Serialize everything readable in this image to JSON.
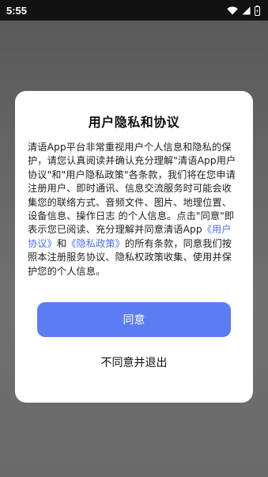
{
  "status_bar": {
    "time": "5:55",
    "icons": [
      "wifi-icon",
      "signal-icon",
      "battery-icon"
    ]
  },
  "dialog": {
    "title": "用户隐私和协议",
    "body": {
      "intro": "清语App平台非常重视用户个人信息和隐私的保护，请您认真阅读并确认充分理解\"清语App用户协议\"和\"用户隐私政策\"各条款，我们将在您申请注册用户、即时通讯、信息交流服务时可能会收集您的联络方式、音频文件、图片、地理位置、设备信息、操作日志 的个人信息。点击\"同意\"即表示您已阅读、充分理解并同意清语App",
      "user_agreement_link": "《用户协议》",
      "connector": "和",
      "privacy_policy_link": "《隐私政策》",
      "outro": "的所有条款，同意我们按照本注册服务协议、隐私权政策收集、使用并保护您的个人信息。"
    },
    "agree_label": "同意",
    "disagree_label": "不同意并退出"
  },
  "colors": {
    "accent": "#5b7cf2",
    "link": "#4a6ff0",
    "overlay": "#6b6b6b",
    "statusbar": "#121212"
  }
}
